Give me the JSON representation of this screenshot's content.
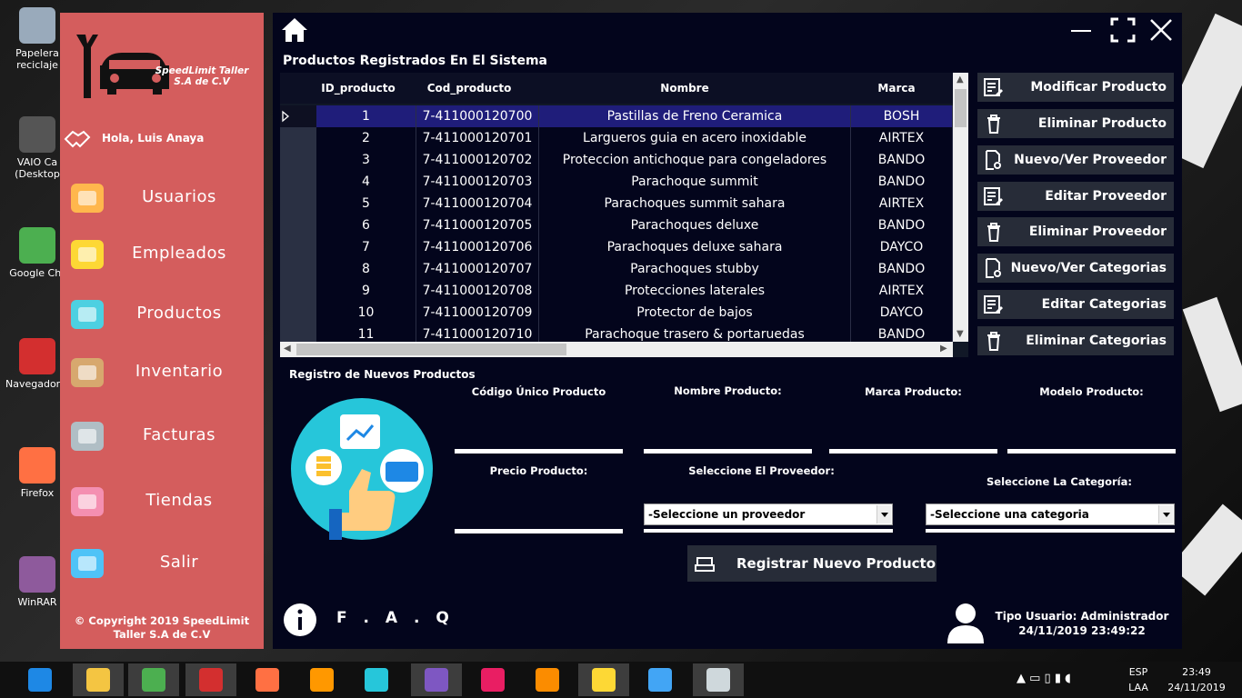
{
  "desktop": {
    "icons": [
      {
        "label1": "Papelera",
        "label2": "reciclaje",
        "color": "#9ab"
      },
      {
        "label1": "VAIO Ca",
        "label2": "(Desktop",
        "color": "#555"
      },
      {
        "label1": "Google Chr",
        "label2": "",
        "color": "#4caf50"
      },
      {
        "label1": "Navegador O",
        "label2": "",
        "color": "#d32f2f"
      },
      {
        "label1": "Firefox",
        "label2": "",
        "color": "#ff7043"
      },
      {
        "label1": "WinRAR",
        "label2": "",
        "color": "#8e5a9c"
      }
    ]
  },
  "sidebar": {
    "logo_text": "SpeedLimit Taller S.A de C.V",
    "greeting": "Hola, Luis Anaya",
    "items": [
      {
        "label": "Usuarios",
        "icon": "user-icon"
      },
      {
        "label": "Empleados",
        "icon": "badge-icon"
      },
      {
        "label": "Productos",
        "icon": "basket-icon"
      },
      {
        "label": "Inventario",
        "icon": "box-icon"
      },
      {
        "label": "Facturas",
        "icon": "register-icon"
      },
      {
        "label": "Tiendas",
        "icon": "store-icon"
      },
      {
        "label": "Salir",
        "icon": "exit-icon"
      }
    ],
    "copyright": "© Copyright 2019 SpeedLimit Taller S.A de C.V"
  },
  "main": {
    "title": "Productos Registrados En El Sistema",
    "columns": [
      "ID_producto",
      "Cod_producto",
      "Nombre",
      "Marca"
    ],
    "rows": [
      [
        "1",
        "7-411000120700",
        "Pastillas de Freno Ceramica",
        "BOSH"
      ],
      [
        "2",
        "7-411000120701",
        "Largueros guia en acero inoxidable",
        "AIRTEX"
      ],
      [
        "3",
        "7-411000120702",
        "Proteccion antichoque para congeladores",
        "BANDO"
      ],
      [
        "4",
        "7-411000120703",
        "Parachoque summit",
        "BANDO"
      ],
      [
        "5",
        "7-411000120704",
        "Parachoques summit sahara",
        "AIRTEX"
      ],
      [
        "6",
        "7-411000120705",
        "Parachoques deluxe",
        "BANDO"
      ],
      [
        "7",
        "7-411000120706",
        "Parachoques deluxe sahara",
        "DAYCO"
      ],
      [
        "8",
        "7-411000120707",
        "Parachoques stubby",
        "BANDO"
      ],
      [
        "9",
        "7-411000120708",
        "Protecciones laterales",
        "AIRTEX"
      ],
      [
        "10",
        "7-411000120709",
        "Protector de bajos",
        "DAYCO"
      ],
      [
        "11",
        "7-411000120710",
        "Parachoque trasero & portaruedas",
        "BANDO"
      ]
    ],
    "actions": [
      {
        "label": "Modificar Producto",
        "icon": "edit-list-icon"
      },
      {
        "label": "Eliminar Producto",
        "icon": "trash-icon"
      },
      {
        "label": "Nuevo/Ver Proveedor",
        "icon": "search-doc-icon"
      },
      {
        "label": "Editar Proveedor",
        "icon": "edit-list-icon"
      },
      {
        "label": "Eliminar Proveedor",
        "icon": "trash-icon"
      },
      {
        "label": "Nuevo/Ver Categorias",
        "icon": "search-doc-icon"
      },
      {
        "label": "Editar Categorias",
        "icon": "edit-list-icon"
      },
      {
        "label": "Eliminar Categorias",
        "icon": "trash-icon"
      }
    ],
    "form": {
      "title": "Registro de Nuevos Productos",
      "codigo_label": "Código Único Producto",
      "nombre_label": "Nombre Producto:",
      "marca_label": "Marca Producto:",
      "modelo_label": "Modelo Producto:",
      "precio_label": "Precio Producto:",
      "proveedor_label": "Seleccione El Proveedor:",
      "categoria_label": "Seleccione La Categoría:",
      "proveedor_value": "-Seleccione un proveedor",
      "categoria_value": "-Seleccione una categoria",
      "register_button": "Registrar Nuevo Producto"
    },
    "footer": {
      "faq": "F . A . Q",
      "user_type": "Tipo Usuario: Administrador",
      "datetime": "24/11/2019 23:49:22"
    }
  },
  "taskbar": {
    "items": [
      {
        "icon": "ie-icon",
        "color": "#1e88e5",
        "open": false
      },
      {
        "icon": "folder-icon",
        "color": "#f4c542",
        "open": true
      },
      {
        "icon": "chrome-icon",
        "color": "#4caf50",
        "open": true
      },
      {
        "icon": "opera-icon",
        "color": "#d32f2f",
        "open": true
      },
      {
        "icon": "firefox-icon",
        "color": "#ff7043",
        "open": false
      },
      {
        "icon": "sublime-icon",
        "color": "#ff9800",
        "open": false
      },
      {
        "icon": "terminal-icon",
        "color": "#26c6da",
        "open": false
      },
      {
        "icon": "visual-studio-icon",
        "color": "#7e57c2",
        "open": true
      },
      {
        "icon": "wamp-icon",
        "color": "#e91e63",
        "open": false
      },
      {
        "icon": "xampp-icon",
        "color": "#fb8c00",
        "open": false
      },
      {
        "icon": "tools-icon",
        "color": "#fdd835",
        "open": true
      },
      {
        "icon": "package-icon",
        "color": "#42a5f5",
        "open": false
      },
      {
        "icon": "plugin-icon",
        "color": "#cfd8dc",
        "open": true
      }
    ],
    "lang1": "ESP",
    "lang2": "LAA",
    "time": "23:49",
    "date": "24/11/2019"
  }
}
